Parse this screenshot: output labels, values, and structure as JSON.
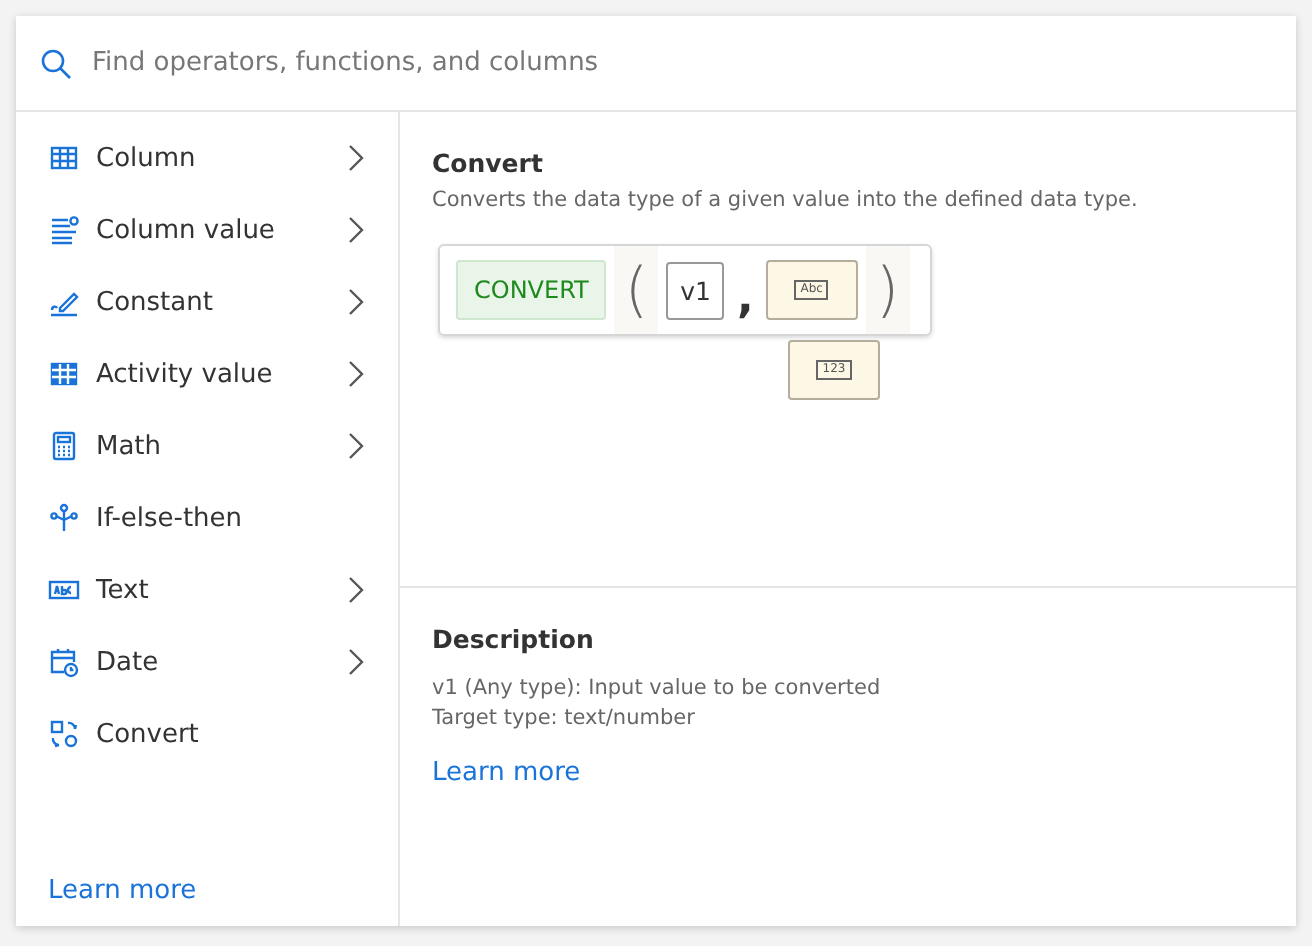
{
  "search": {
    "placeholder": "Find operators, functions, and columns"
  },
  "sidebar": {
    "items": [
      {
        "label": "Column",
        "kind": "column",
        "has_submenu": true
      },
      {
        "label": "Column value",
        "kind": "columnvalue",
        "has_submenu": true
      },
      {
        "label": "Constant",
        "kind": "constant",
        "has_submenu": true
      },
      {
        "label": "Activity value",
        "kind": "activity",
        "has_submenu": true
      },
      {
        "label": "Math",
        "kind": "math",
        "has_submenu": true
      },
      {
        "label": "If-else-then",
        "kind": "condition",
        "has_submenu": false
      },
      {
        "label": "Text",
        "kind": "text",
        "has_submenu": true
      },
      {
        "label": "Date",
        "kind": "date",
        "has_submenu": true
      },
      {
        "label": "Convert",
        "kind": "convert",
        "has_submenu": false
      }
    ],
    "link": "Learn more"
  },
  "detail": {
    "title": "Convert",
    "subtitle": "Converts the data type of a given value into the defined data type.",
    "expression": {
      "function": "CONVERT",
      "open": "(",
      "argument": "v1",
      "separator": ",",
      "type_options": [
        "Abc",
        "123"
      ],
      "close": ")"
    },
    "description": {
      "heading": "Description",
      "lines": [
        "v1 (Any type): Input value to be converted",
        "Target type: text/number"
      ],
      "link": "Learn more"
    }
  }
}
